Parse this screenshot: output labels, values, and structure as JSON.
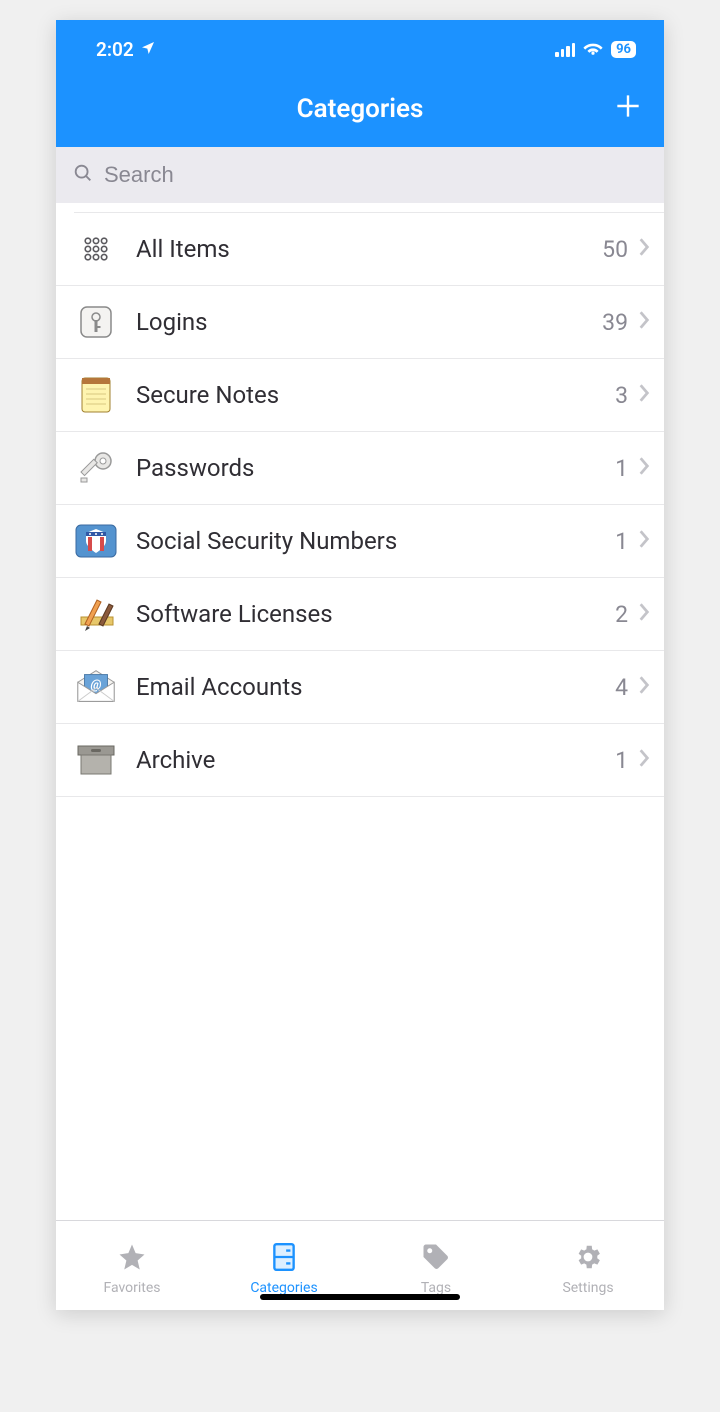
{
  "statusBar": {
    "time": "2:02",
    "battery": "96"
  },
  "nav": {
    "title": "Categories"
  },
  "search": {
    "placeholder": "Search"
  },
  "categories": [
    {
      "id": "all-items",
      "label": "All Items",
      "count": "50",
      "icon": "grid"
    },
    {
      "id": "logins",
      "label": "Logins",
      "count": "39",
      "icon": "key-box"
    },
    {
      "id": "secure-notes",
      "label": "Secure Notes",
      "count": "3",
      "icon": "notepad"
    },
    {
      "id": "passwords",
      "label": "Passwords",
      "count": "1",
      "icon": "key"
    },
    {
      "id": "ssn",
      "label": "Social Security Numbers",
      "count": "1",
      "icon": "shield"
    },
    {
      "id": "software-licenses",
      "label": "Software Licenses",
      "count": "2",
      "icon": "apps"
    },
    {
      "id": "email-accounts",
      "label": "Email Accounts",
      "count": "4",
      "icon": "envelope"
    },
    {
      "id": "archive",
      "label": "Archive",
      "count": "1",
      "icon": "archive"
    }
  ],
  "tabs": {
    "favorites": "Favorites",
    "categories": "Categories",
    "tags": "Tags",
    "settings": "Settings"
  }
}
